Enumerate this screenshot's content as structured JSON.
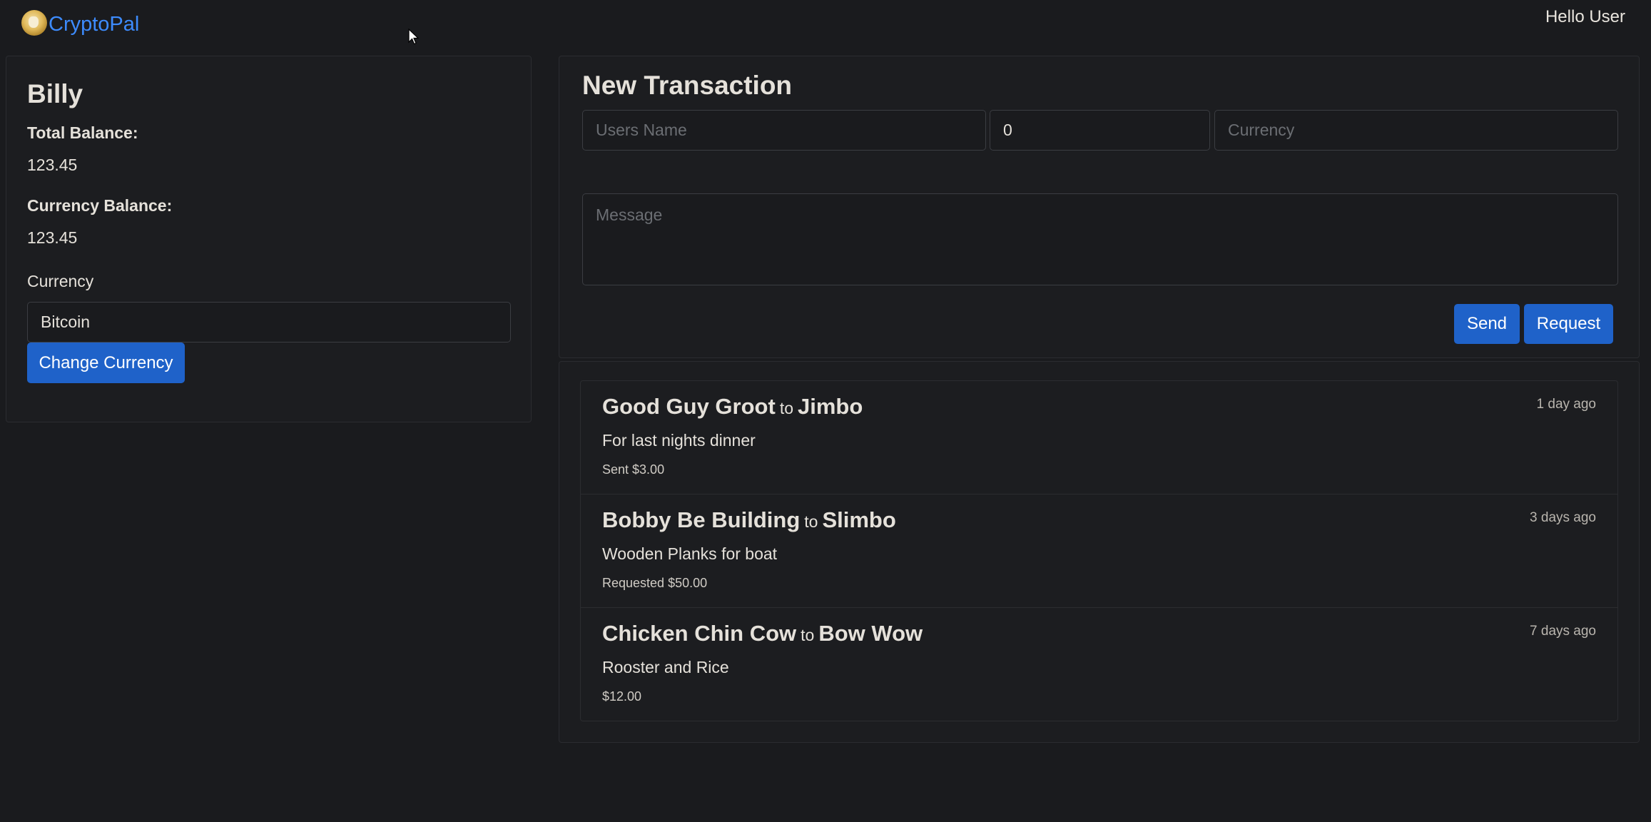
{
  "nav": {
    "brand": "CryptoPal",
    "greeting": "Hello User"
  },
  "account": {
    "name": "Billy",
    "total_balance_label": "Total Balance:",
    "total_balance": "123.45",
    "currency_balance_label": "Currency Balance:",
    "currency_balance": "123.45",
    "currency_label": "Currency",
    "currency_value": "Bitcoin",
    "change_currency_button": "Change Currency"
  },
  "new_transaction": {
    "title": "New Transaction",
    "users_name_placeholder": "Users Name",
    "amount_value": "0",
    "currency_placeholder": "Currency",
    "message_placeholder": "Message",
    "send_button": "Send",
    "request_button": "Request"
  },
  "transactions": [
    {
      "from": "Good Guy Groot",
      "to_word": "to",
      "to": "Jimbo",
      "time": "1 day ago",
      "message": "For last nights dinner",
      "amount": "Sent $3.00"
    },
    {
      "from": "Bobby Be Building",
      "to_word": "to",
      "to": "Slimbo",
      "time": "3 days ago",
      "message": "Wooden Planks for boat",
      "amount": "Requested $50.00"
    },
    {
      "from": "Chicken Chin Cow",
      "to_word": "to",
      "to": "Bow Wow",
      "time": "7 days ago",
      "message": "Rooster and Rice",
      "amount": "$12.00"
    }
  ],
  "icons": {
    "logo": "doge-coin-logo",
    "cursor": "mouse-pointer-icon"
  },
  "colors": {
    "background": "#1a1b1e",
    "brand": "#3d8bfd",
    "button": "#1f62c9"
  }
}
